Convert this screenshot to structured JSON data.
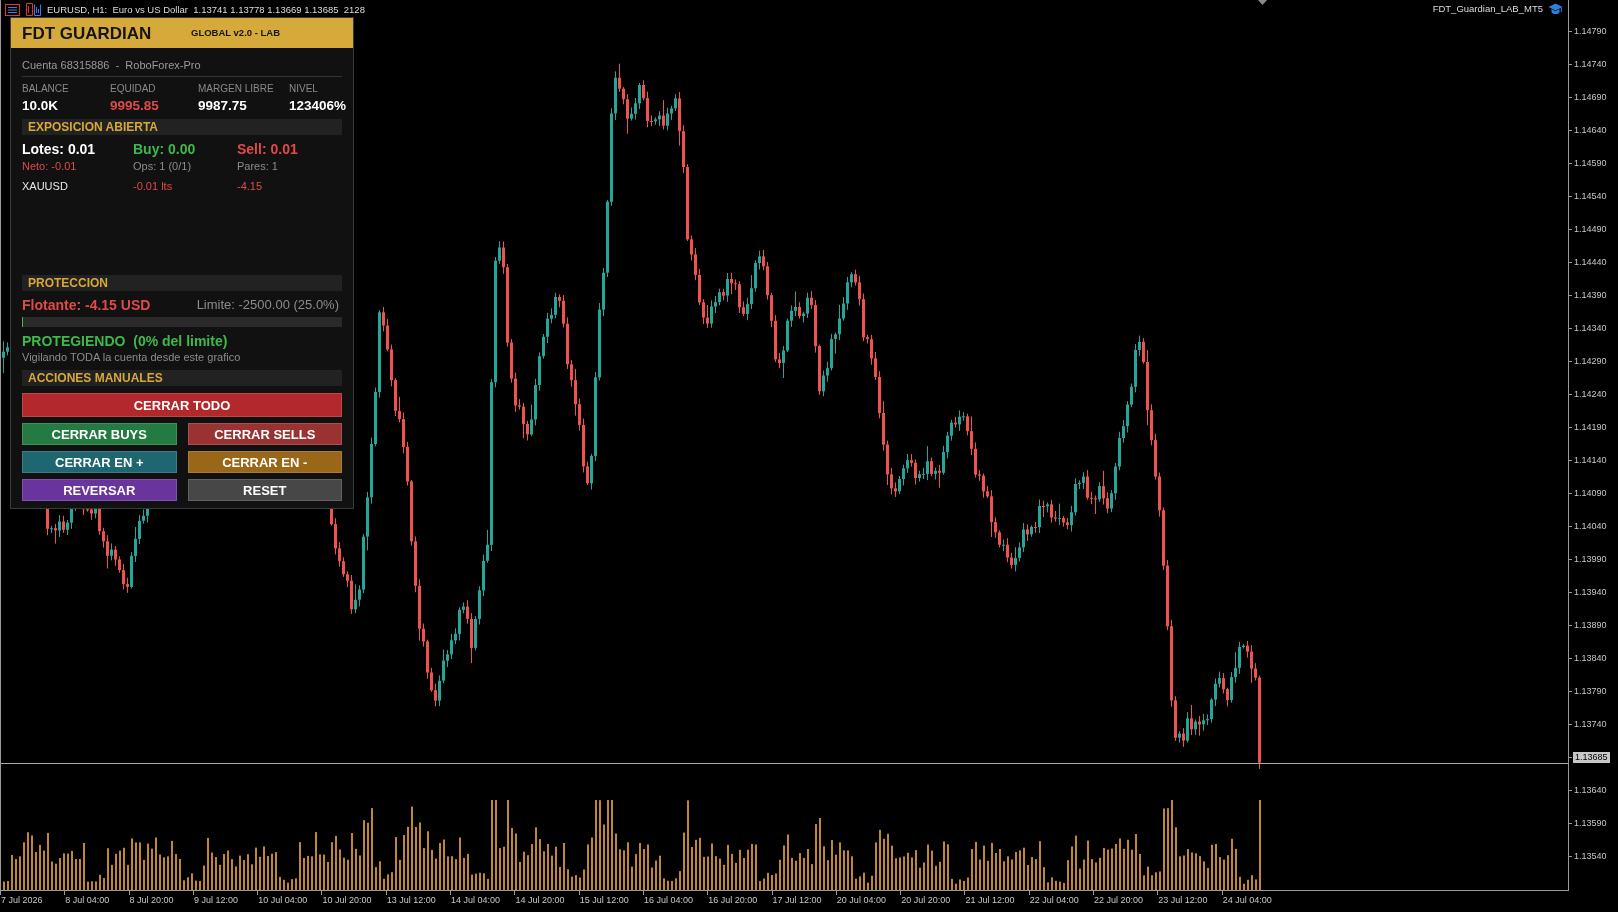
{
  "chart_header": {
    "symbol_info": "EURUSD, H1:  Euro vs US Dollar  1.13741 1.13778 1.13669 1.13685  2128",
    "expert_name": "FDT_Guardian_LAB_MT5"
  },
  "panel": {
    "title": "FDT GUARDIAN",
    "subtitle": "GLOBAL v2.0 - LAB",
    "account": "Cuenta 68315886  -  RoboForex-Pro",
    "stats": [
      {
        "label": "BALANCE",
        "value": "10.0K",
        "color": "#ffffff"
      },
      {
        "label": "EQUIDAD",
        "value": "9995.85",
        "color": "#e04a4a"
      },
      {
        "label": "MARGEN LIBRE",
        "value": "9987.75",
        "color": "#ffffff"
      },
      {
        "label": "NIVEL",
        "value": "123406%",
        "color": "#ffffff"
      }
    ],
    "exposure": {
      "heading": "EXPOSICION ABIERTA",
      "totals": [
        {
          "text": "Lotes: 0.01",
          "color": "#ffffff"
        },
        {
          "text": "Buy: 0.00",
          "color": "#3dba49"
        },
        {
          "text": "Sell: 0.01",
          "color": "#e04a4a"
        }
      ],
      "details": [
        {
          "text": "Neto: -0.01",
          "color": "#e04a4a"
        },
        {
          "text": "Ops: 1 (0/1)",
          "color": "#8c8c8c"
        },
        {
          "text": "Pares: 1",
          "color": "#8c8c8c"
        }
      ],
      "positions": [
        {
          "symbol": "XAUUSD",
          "lots": "-0.01 lts",
          "profit": "-4.15"
        }
      ]
    },
    "protection": {
      "heading": "PROTECCION",
      "floating": "Flotante: -4.15 USD",
      "limit": "Limite: -2500.00 (25.0%)",
      "level": 0.003,
      "status": "PROTEGIENDO  (0% del limite)",
      "note": "Vigilando TODA la cuenta desde este grafico"
    },
    "actions": {
      "heading": "ACCIONES MANUALES",
      "buttons": [
        {
          "label": "CERRAR TODO",
          "kind": "wide",
          "color": "#b2282b"
        },
        {
          "label": "CERRAR BUYS",
          "kind": "half",
          "color": "#237b41"
        },
        {
          "label": "CERRAR SELLS",
          "kind": "half",
          "color": "#9b3232"
        },
        {
          "label": "CERRAR EN +",
          "kind": "half",
          "color": "#1e6670"
        },
        {
          "label": "CERRAR EN -",
          "kind": "half",
          "color": "#9a6618"
        },
        {
          "label": "REVERSAR",
          "kind": "half",
          "color": "#6a349e"
        },
        {
          "label": "RESET",
          "kind": "half",
          "color": "#474747"
        }
      ]
    }
  },
  "chart": {
    "price_axis": [
      {
        "text": "1.14790",
        "kind": "tick"
      },
      {
        "text": "1.14740",
        "kind": "tick"
      },
      {
        "text": "1.14690",
        "kind": "tick"
      },
      {
        "text": "1.14640",
        "kind": "tick"
      },
      {
        "text": "1.14590",
        "kind": "tick"
      },
      {
        "text": "1.14540",
        "kind": "tick"
      },
      {
        "text": "1.14490",
        "kind": "tick"
      },
      {
        "text": "1.14440",
        "kind": "tick"
      },
      {
        "text": "1.14390",
        "kind": "tick"
      },
      {
        "text": "1.14340",
        "kind": "tick"
      },
      {
        "text": "1.14290",
        "kind": "tick"
      },
      {
        "text": "1.14240",
        "kind": "tick"
      },
      {
        "text": "1.14190",
        "kind": "tick"
      },
      {
        "text": "1.14140",
        "kind": "tick"
      },
      {
        "text": "1.14090",
        "kind": "tick"
      },
      {
        "text": "1.14040",
        "kind": "tick"
      },
      {
        "text": "1.13990",
        "kind": "tick"
      },
      {
        "text": "1.13940",
        "kind": "tick"
      },
      {
        "text": "1.13890",
        "kind": "tick"
      },
      {
        "text": "1.13840",
        "kind": "tick"
      },
      {
        "text": "1.13790",
        "kind": "tick"
      },
      {
        "text": "1.13740",
        "kind": "tick"
      },
      {
        "text": "1.13685",
        "kind": "current"
      },
      {
        "text": "1.13640",
        "kind": "tick"
      },
      {
        "text": "1.13590",
        "kind": "tick"
      },
      {
        "text": "1.13540",
        "kind": "tick"
      }
    ],
    "time_axis": [
      "7 Jul 2026",
      "8 Jul 04:00",
      "8 Jul 20:00",
      "9 Jul 12:00",
      "10 Jul 04:00",
      "10 Jul 20:00",
      "13 Jul 12:00",
      "14 Jul 04:00",
      "14 Jul 20:00",
      "15 Jul 12:00",
      "16 Jul 04:00",
      "16 Jul 20:00",
      "17 Jul 12:00",
      "20 Jul 04:00",
      "20 Jul 20:00",
      "21 Jul 12:00",
      "22 Jul 04:00",
      "22 Jul 20:00",
      "23 Jul 12:00",
      "24 Jul 04:00"
    ]
  }
}
